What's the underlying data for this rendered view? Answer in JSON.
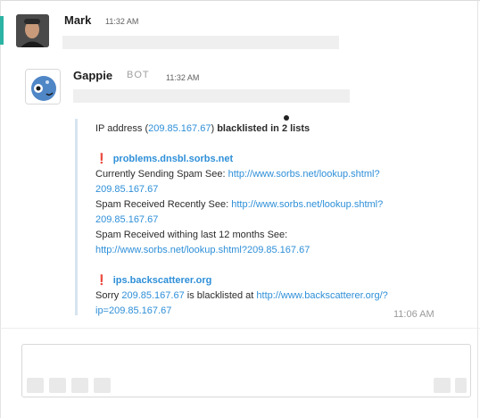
{
  "messages": [
    {
      "author": "Mark",
      "time": "11:32 AM",
      "avatar_icon": "user-photo"
    },
    {
      "author": "Gappie",
      "badge": "BOT",
      "time": "11:32 AM",
      "avatar_icon": "gappie-bot-icon",
      "attachment": {
        "intro_prefix": "IP address (",
        "intro_ip": "209.85.167.67",
        "intro_mid": ") ",
        "intro_bold": "blacklisted in 2 lists",
        "list1": {
          "title": "problems.dnsbl.sorbs.net",
          "lines": [
            {
              "text": "Currently Sending Spam See: ",
              "link": "http://www.sorbs.net/lookup.shtml?",
              "link_cont": "209.85.167.67"
            },
            {
              "text": "Spam Received Recently See: ",
              "link": "http://www.sorbs.net/lookup.shtml?",
              "link_cont": "209.85.167.67"
            },
            {
              "text": "Spam Received withing last 12 months See:",
              "link": "",
              "link_cont": "http://www.sorbs.net/lookup.shtml?209.85.167.67"
            }
          ]
        },
        "list2": {
          "title": "ips.backscatterer.org",
          "sorry": "Sorry ",
          "ip": "209.85.167.67",
          "mid": " is blacklisted at ",
          "link": "http://www.backscatterer.org/?",
          "link_cont": "ip=209.85.167.67"
        },
        "time": "11:06 AM"
      }
    }
  ],
  "composer": {
    "placeholder": ""
  },
  "colors": {
    "link": "#2e8fd8",
    "alert": "#e01e2d",
    "accent": "#2bb3a3"
  }
}
